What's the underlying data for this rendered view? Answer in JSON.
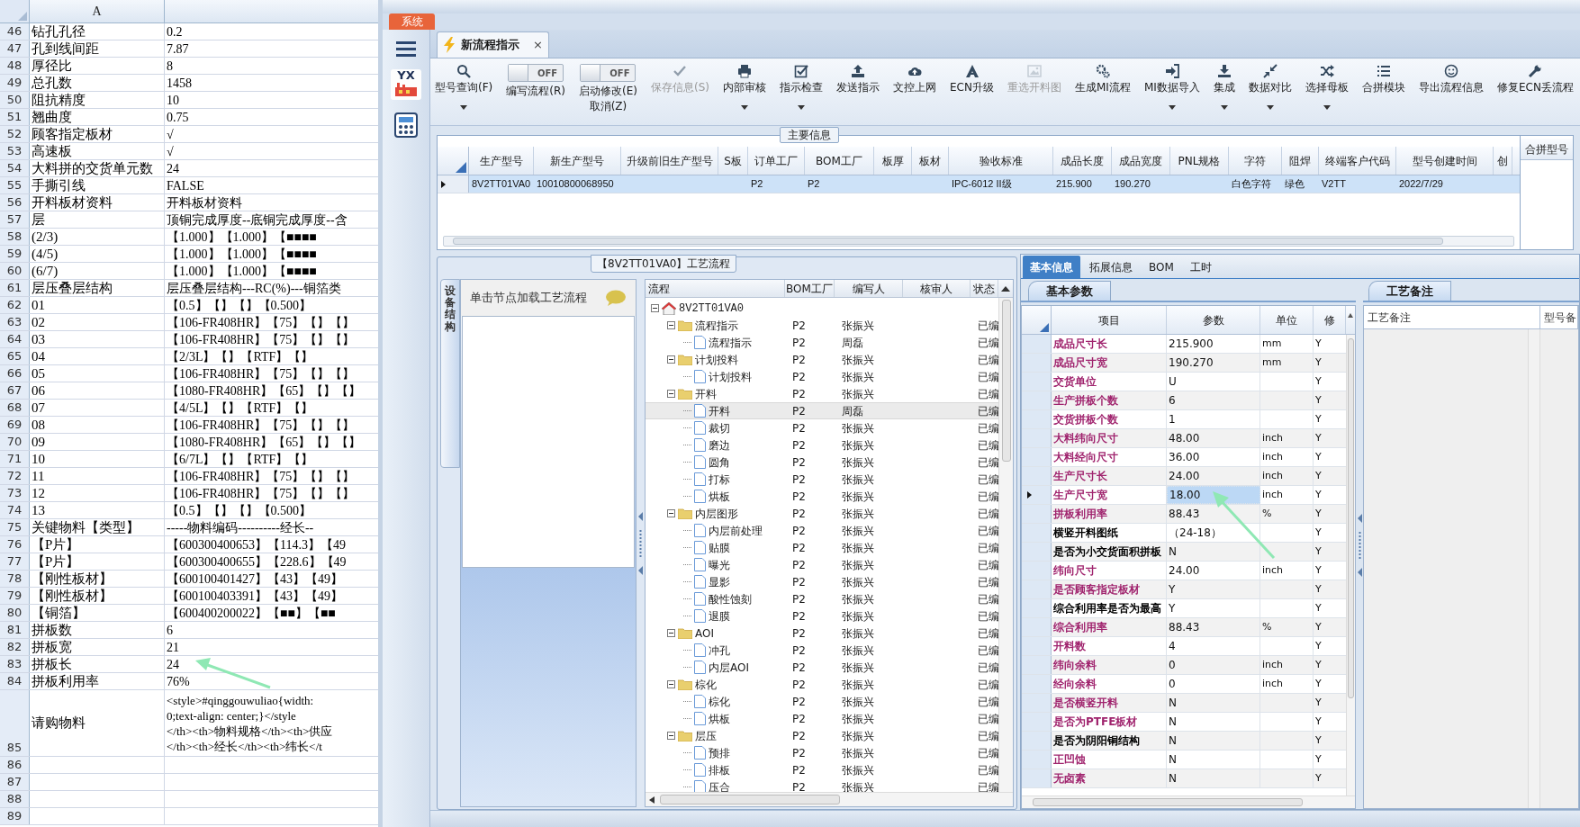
{
  "spreadsheet": {
    "column_header": "A",
    "rows": [
      {
        "number": "46",
        "a": "钻孔孔径",
        "b": "0.2"
      },
      {
        "number": "47",
        "a": "孔到线间距",
        "b": "7.87"
      },
      {
        "number": "48",
        "a": "厚径比",
        "b": "8"
      },
      {
        "number": "49",
        "a": "总孔数",
        "b": "1458"
      },
      {
        "number": "50",
        "a": "阻抗精度",
        "b": "10"
      },
      {
        "number": "51",
        "a": "翘曲度",
        "b": "0.75"
      },
      {
        "number": "52",
        "a": "顾客指定板材",
        "b": "√"
      },
      {
        "number": "53",
        "a": "高速板",
        "b": "√"
      },
      {
        "number": "54",
        "a": "大料拼的交货单元数",
        "b": "24"
      },
      {
        "number": "55",
        "a": "手撕引线",
        "b": "FALSE"
      },
      {
        "number": "56",
        "a": "开料板材资料",
        "b": "开料板材资料"
      },
      {
        "number": "57",
        "a": "层",
        "b": "顶铜完成厚度--底铜完成厚度--含"
      },
      {
        "number": "58",
        "a": "(2/3)",
        "b": "【1.000】【1.000】【■■■■"
      },
      {
        "number": "59",
        "a": "(4/5)",
        "b": "【1.000】【1.000】【■■■■"
      },
      {
        "number": "60",
        "a": "(6/7)",
        "b": "【1.000】【1.000】【■■■■"
      },
      {
        "number": "61",
        "a": "层压叠层结构",
        "b": "层压叠层结构---RC(%)---铜箔类"
      },
      {
        "number": "62",
        "a": "01",
        "b": "【0.5】【】【】【0.500】"
      },
      {
        "number": "63",
        "a": "02",
        "b": "【106-FR408HR】【75】【】【】"
      },
      {
        "number": "64",
        "a": "03",
        "b": "【106-FR408HR】【75】【】【】"
      },
      {
        "number": "65",
        "a": "04",
        "b": "【2/3L】【】【RTF】【】"
      },
      {
        "number": "66",
        "a": "05",
        "b": "【106-FR408HR】【75】【】【】"
      },
      {
        "number": "67",
        "a": "06",
        "b": "【1080-FR408HR】【65】【】【】"
      },
      {
        "number": "68",
        "a": "07",
        "b": "【4/5L】【】【RTF】【】"
      },
      {
        "number": "69",
        "a": "08",
        "b": "【106-FR408HR】【75】【】【】"
      },
      {
        "number": "70",
        "a": "09",
        "b": "【1080-FR408HR】【65】【】【】"
      },
      {
        "number": "71",
        "a": "10",
        "b": "【6/7L】【】【RTF】【】"
      },
      {
        "number": "72",
        "a": "11",
        "b": "【106-FR408HR】【75】【】【】"
      },
      {
        "number": "73",
        "a": "12",
        "b": "【106-FR408HR】【75】【】【】"
      },
      {
        "number": "74",
        "a": "13",
        "b": "【0.5】【】【】【0.500】"
      },
      {
        "number": "75",
        "a": "关键物料【类型】",
        "b": "-----物料编码----------经长--"
      },
      {
        "number": "76",
        "a": "【P片】",
        "b": "【600300400653】【114.3】【49"
      },
      {
        "number": "77",
        "a": "【P片】",
        "b": "【600300400655】【228.6】【49"
      },
      {
        "number": "78",
        "a": "【刚性板材】",
        "b": "【600100401427】【43】【49】"
      },
      {
        "number": "79",
        "a": "【刚性板材】",
        "b": "【600100403391】【43】【49】"
      },
      {
        "number": "80",
        "a": "【铜箔】",
        "b": "【600400200022】【■■】【■■"
      },
      {
        "number": "81",
        "a": "拼板数",
        "b": "6"
      },
      {
        "number": "82",
        "a": "拼板宽",
        "b": "21"
      },
      {
        "number": "83",
        "a": "拼板长",
        "b": "24"
      },
      {
        "number": "84",
        "a": "拼板利用率",
        "b": "76%"
      },
      {
        "number": "85",
        "a": "请购物料",
        "b_lines": [
          "<style>#qinggouwuliao{width:",
          "0;text-align: center;}</style",
          "</th><th>物料规格</th><th>供应",
          "</th><th>经长</th><th>纬长</t"
        ]
      },
      {
        "number": "86"
      },
      {
        "number": "87"
      },
      {
        "number": "88"
      },
      {
        "number": "89"
      }
    ]
  },
  "system_tab": "系统",
  "sidebar": {
    "logo_text": "YX"
  },
  "document_tab": {
    "label": "新流程指示",
    "close": "×",
    "selected": true
  },
  "toolbar": [
    {
      "kind": "button",
      "label": "型号查询(F)",
      "dropdown": true,
      "disabled": false
    },
    {
      "kind": "toggle",
      "switch_text": "OFF",
      "on": false,
      "label": "编写流程(R)"
    },
    {
      "kind": "toggle",
      "switch_text": "OFF",
      "on": false,
      "label": "启动修改(E)",
      "label_2": "取消(Z)"
    },
    {
      "kind": "button",
      "label": "保存信息(S)",
      "dropdown": false,
      "disabled": true
    },
    {
      "kind": "button",
      "label": "内部审核",
      "dropdown": true,
      "disabled": false
    },
    {
      "kind": "button",
      "label": "指示检查",
      "dropdown": true,
      "disabled": false
    },
    {
      "kind": "button",
      "label": "发送指示",
      "dropdown": false,
      "disabled": false
    },
    {
      "kind": "button",
      "label": "文控上网",
      "dropdown": false,
      "disabled": false
    },
    {
      "kind": "button",
      "label": "ECN升级",
      "dropdown": false,
      "disabled": false
    },
    {
      "kind": "button",
      "label": "重选开料图",
      "dropdown": false,
      "disabled": true
    },
    {
      "kind": "button",
      "label": "生成MI流程",
      "dropdown": false,
      "disabled": false
    },
    {
      "kind": "button",
      "label": "MI数据导入",
      "dropdown": true,
      "disabled": false
    },
    {
      "kind": "button",
      "label": "集成",
      "dropdown": true,
      "disabled": false
    },
    {
      "kind": "button",
      "label": "数据对比",
      "dropdown": true,
      "disabled": false
    },
    {
      "kind": "button",
      "label": "选择母板",
      "dropdown": true,
      "disabled": false
    },
    {
      "kind": "button",
      "label": "合拼模块",
      "dropdown": false,
      "disabled": false
    },
    {
      "kind": "button",
      "label": "导出流程信息",
      "dropdown": false,
      "disabled": false
    },
    {
      "kind": "button",
      "label": "修复ECN丢流程",
      "dropdown": false,
      "disabled": false
    }
  ],
  "main_info": {
    "title": "主要信息",
    "columns": [
      "生产型号",
      "新生产型号",
      "升级前旧生产型号",
      "S板",
      "订单工厂",
      "BOM工厂",
      "板厚",
      "板材",
      "验收标准",
      "成品长度",
      "成品宽度",
      "PNL规格",
      "字符",
      "阻焊",
      "终端客户代码",
      "型号创建时间",
      "创"
    ],
    "rows": [
      {
        "selected": true,
        "cells": [
          "8V2TT01VA0",
          "10010800068950",
          "",
          "",
          "P2",
          "P2",
          "",
          "",
          "IPC-6012 II级",
          "215.900",
          "190.270",
          "",
          "白色字符",
          "绿色",
          "V2TT",
          "2022/7/29",
          ""
        ]
      }
    ],
    "side_column": "合拼型号"
  },
  "process": {
    "title": "【8V2TT01VA0】工艺流程",
    "side_tab": "设备结构",
    "hint": "单击节点加载工艺流程",
    "columns": [
      "流程",
      "BOM工厂",
      "编写人",
      "核审人",
      "状态"
    ],
    "tree": [
      {
        "kind": "root",
        "label": "8V2TT01VA0",
        "expanded": true,
        "selected": false,
        "children": [
          {
            "kind": "folder",
            "label": "流程指示",
            "bom": "P2",
            "writer": "张振兴",
            "status": "已编",
            "expanded": true,
            "selected": false,
            "children": [
              {
                "kind": "file",
                "label": "流程指示",
                "bom": "P2",
                "writer": "周磊",
                "status": "已编",
                "selected": false
              }
            ]
          },
          {
            "kind": "folder",
            "label": "计划投料",
            "bom": "P2",
            "writer": "张振兴",
            "status": "已编",
            "expanded": true,
            "selected": false,
            "children": [
              {
                "kind": "file",
                "label": "计划投料",
                "bom": "P2",
                "writer": "张振兴",
                "status": "已编",
                "selected": false
              }
            ]
          },
          {
            "kind": "folder",
            "label": "开料",
            "bom": "P2",
            "writer": "张振兴",
            "status": "已编",
            "expanded": true,
            "selected": false,
            "children": [
              {
                "kind": "file",
                "label": "开料",
                "bom": "P2",
                "writer": "周磊",
                "status": "已编",
                "selected": true
              },
              {
                "kind": "file",
                "label": "裁切",
                "bom": "P2",
                "writer": "张振兴",
                "status": "已编",
                "selected": false
              },
              {
                "kind": "file",
                "label": "磨边",
                "bom": "P2",
                "writer": "张振兴",
                "status": "已编",
                "selected": false
              },
              {
                "kind": "file",
                "label": "圆角",
                "bom": "P2",
                "writer": "张振兴",
                "status": "已编",
                "selected": false
              },
              {
                "kind": "file",
                "label": "打标",
                "bom": "P2",
                "writer": "张振兴",
                "status": "已编",
                "selected": false
              },
              {
                "kind": "file",
                "label": "烘板",
                "bom": "P2",
                "writer": "张振兴",
                "status": "已编",
                "selected": false
              }
            ]
          },
          {
            "kind": "folder",
            "label": "内层图形",
            "bom": "P2",
            "writer": "张振兴",
            "status": "已编",
            "expanded": true,
            "selected": false,
            "children": [
              {
                "kind": "file",
                "label": "内层前处理",
                "bom": "P2",
                "writer": "张振兴",
                "status": "已编",
                "selected": false
              },
              {
                "kind": "file",
                "label": "贴膜",
                "bom": "P2",
                "writer": "张振兴",
                "status": "已编",
                "selected": false
              },
              {
                "kind": "file",
                "label": "曝光",
                "bom": "P2",
                "writer": "张振兴",
                "status": "已编",
                "selected": false
              },
              {
                "kind": "file",
                "label": "显影",
                "bom": "P2",
                "writer": "张振兴",
                "status": "已编",
                "selected": false
              },
              {
                "kind": "file",
                "label": "酸性蚀刻",
                "bom": "P2",
                "writer": "张振兴",
                "status": "已编",
                "selected": false
              },
              {
                "kind": "file",
                "label": "退膜",
                "bom": "P2",
                "writer": "张振兴",
                "status": "已编",
                "selected": false
              }
            ]
          },
          {
            "kind": "folder",
            "label": "AOI",
            "bom": "P2",
            "writer": "张振兴",
            "status": "已编",
            "expanded": true,
            "selected": false,
            "children": [
              {
                "kind": "file",
                "label": "冲孔",
                "bom": "P2",
                "writer": "张振兴",
                "status": "已编",
                "selected": false
              },
              {
                "kind": "file",
                "label": "内层AOI",
                "bom": "P2",
                "writer": "张振兴",
                "status": "已编",
                "selected": false
              }
            ]
          },
          {
            "kind": "folder",
            "label": "棕化",
            "bom": "P2",
            "writer": "张振兴",
            "status": "已编",
            "expanded": true,
            "selected": false,
            "children": [
              {
                "kind": "file",
                "label": "棕化",
                "bom": "P2",
                "writer": "张振兴",
                "status": "已编",
                "selected": false
              },
              {
                "kind": "file",
                "label": "烘板",
                "bom": "P2",
                "writer": "张振兴",
                "status": "已编",
                "selected": false
              }
            ]
          },
          {
            "kind": "folder",
            "label": "层压",
            "bom": "P2",
            "writer": "张振兴",
            "status": "已编",
            "expanded": true,
            "selected": false,
            "children": [
              {
                "kind": "file",
                "label": "预排",
                "bom": "P2",
                "writer": "张振兴",
                "status": "已编",
                "selected": false
              },
              {
                "kind": "file",
                "label": "排板",
                "bom": "P2",
                "writer": "张振兴",
                "status": "已编",
                "selected": false
              },
              {
                "kind": "file",
                "label": "压合",
                "bom": "P2",
                "writer": "张振兴",
                "status": "已编",
                "selected": false
              }
            ]
          }
        ]
      }
    ]
  },
  "detail_tabs": [
    {
      "label": "基本信息",
      "selected": true
    },
    {
      "label": "拓展信息",
      "selected": false
    },
    {
      "label": "BOM",
      "selected": false
    },
    {
      "label": "工时",
      "selected": false
    }
  ],
  "basic_params": {
    "title": "基本参数",
    "columns": [
      "项目",
      "参数",
      "单位",
      "修"
    ],
    "rows": [
      {
        "item": "成品尺寸长",
        "value": "215.900",
        "unit": "mm",
        "flag": "Y",
        "color": "#a0246e",
        "selected": false
      },
      {
        "item": "成品尺寸宽",
        "value": "190.270",
        "unit": "mm",
        "flag": "Y",
        "color": "#a0246e",
        "selected": false
      },
      {
        "item": "交货单位",
        "value": "U",
        "unit": "",
        "flag": "Y",
        "color": "#a0246e",
        "selected": false
      },
      {
        "item": "生产拼板个数",
        "value": "6",
        "unit": "",
        "flag": "Y",
        "color": "#a0246e",
        "selected": false
      },
      {
        "item": "交货拼板个数",
        "value": "1",
        "unit": "",
        "flag": "Y",
        "color": "#a0246e",
        "selected": false
      },
      {
        "item": "大料纬向尺寸",
        "value": "48.00",
        "unit": "inch",
        "flag": "Y",
        "color": "#a0246e",
        "selected": false
      },
      {
        "item": "大料经向尺寸",
        "value": "36.00",
        "unit": "inch",
        "flag": "Y",
        "color": "#a0246e",
        "selected": false
      },
      {
        "item": "生产尺寸长",
        "value": "24.00",
        "unit": "inch",
        "flag": "Y",
        "color": "#a0246e",
        "selected": false
      },
      {
        "item": "生产尺寸宽",
        "value": "18.00",
        "unit": "inch",
        "flag": "Y",
        "color": "#a0246e",
        "selected": true
      },
      {
        "item": "拼板利用率",
        "value": "88.43",
        "unit": "%",
        "flag": "Y",
        "color": "#a0246e",
        "selected": false
      },
      {
        "item": "横竖开料图纸",
        "value": "（24-18）",
        "unit": "",
        "flag": "Y",
        "color": "#000000",
        "selected": false
      },
      {
        "item": "是否为小交货面积拼板",
        "value": "N",
        "unit": "",
        "flag": "Y",
        "color": "#000000",
        "selected": false
      },
      {
        "item": "纬向尺寸",
        "value": "24.00",
        "unit": "inch",
        "flag": "Y",
        "color": "#a0246e",
        "selected": false
      },
      {
        "item": "是否顾客指定板材",
        "value": "Y",
        "unit": "",
        "flag": "Y",
        "color": "#a0246e",
        "selected": false
      },
      {
        "item": "综合利用率是否为最高",
        "value": "Y",
        "unit": "",
        "flag": "Y",
        "color": "#000000",
        "selected": false
      },
      {
        "item": "综合利用率",
        "value": "88.43",
        "unit": "%",
        "flag": "Y",
        "color": "#a0246e",
        "selected": false
      },
      {
        "item": "开料数",
        "value": "4",
        "unit": "",
        "flag": "Y",
        "color": "#a0246e",
        "selected": false
      },
      {
        "item": "纬向余料",
        "value": "0",
        "unit": "inch",
        "flag": "Y",
        "color": "#a0246e",
        "selected": false
      },
      {
        "item": "经向余料",
        "value": "0",
        "unit": "inch",
        "flag": "Y",
        "color": "#a0246e",
        "selected": false
      },
      {
        "item": "是否横竖开料",
        "value": "N",
        "unit": "",
        "flag": "Y",
        "color": "#a0246e",
        "selected": false
      },
      {
        "item": "是否为PTFE板材",
        "value": "N",
        "unit": "",
        "flag": "Y",
        "color": "#a0246e",
        "selected": false
      },
      {
        "item": "是否为阴阳铜结构",
        "value": "N",
        "unit": "",
        "flag": "Y",
        "color": "#000000",
        "selected": false
      },
      {
        "item": "正凹蚀",
        "value": "N",
        "unit": "",
        "flag": "Y",
        "color": "#a0246e",
        "selected": false
      },
      {
        "item": "无卤素",
        "value": "N",
        "unit": "",
        "flag": "Y",
        "color": "#a0246e",
        "selected": false
      }
    ]
  },
  "process_remarks": {
    "title": "工艺备注",
    "columns": [
      "工艺备注",
      "型号备"
    ]
  }
}
